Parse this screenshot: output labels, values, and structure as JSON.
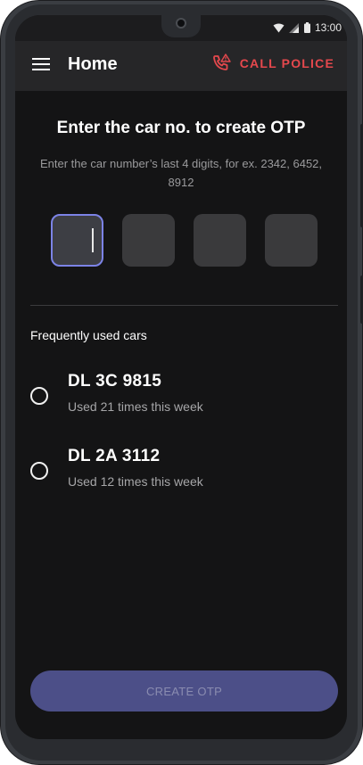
{
  "status_bar": {
    "time": "13:00",
    "icons": [
      "wifi-icon",
      "signal-icon",
      "battery-icon"
    ]
  },
  "app_bar": {
    "title": "Home",
    "menu_icon": "hamburger-menu-icon",
    "call_police_label": "CALL POLICE",
    "call_police_icon": "phone-alert-icon"
  },
  "otp": {
    "heading": "Enter the car no. to create OTP",
    "subtext": "Enter the car number’s last 4 digits, for ex. 2342, 6452, 8912",
    "digits": [
      "",
      "",
      "",
      ""
    ]
  },
  "frequent": {
    "label": "Frequently used cars",
    "cars": [
      {
        "number": "DL 3C 9815",
        "usage": "Used 21 times this week"
      },
      {
        "number": "DL 2A 3112",
        "usage": "Used 12 times this week"
      }
    ]
  },
  "actions": {
    "create_otp_label": "CREATE OTP"
  },
  "colors": {
    "accent": "#e5484d",
    "focus": "#7c83e6",
    "primary_button": "#4c4f88",
    "background": "#141415"
  }
}
